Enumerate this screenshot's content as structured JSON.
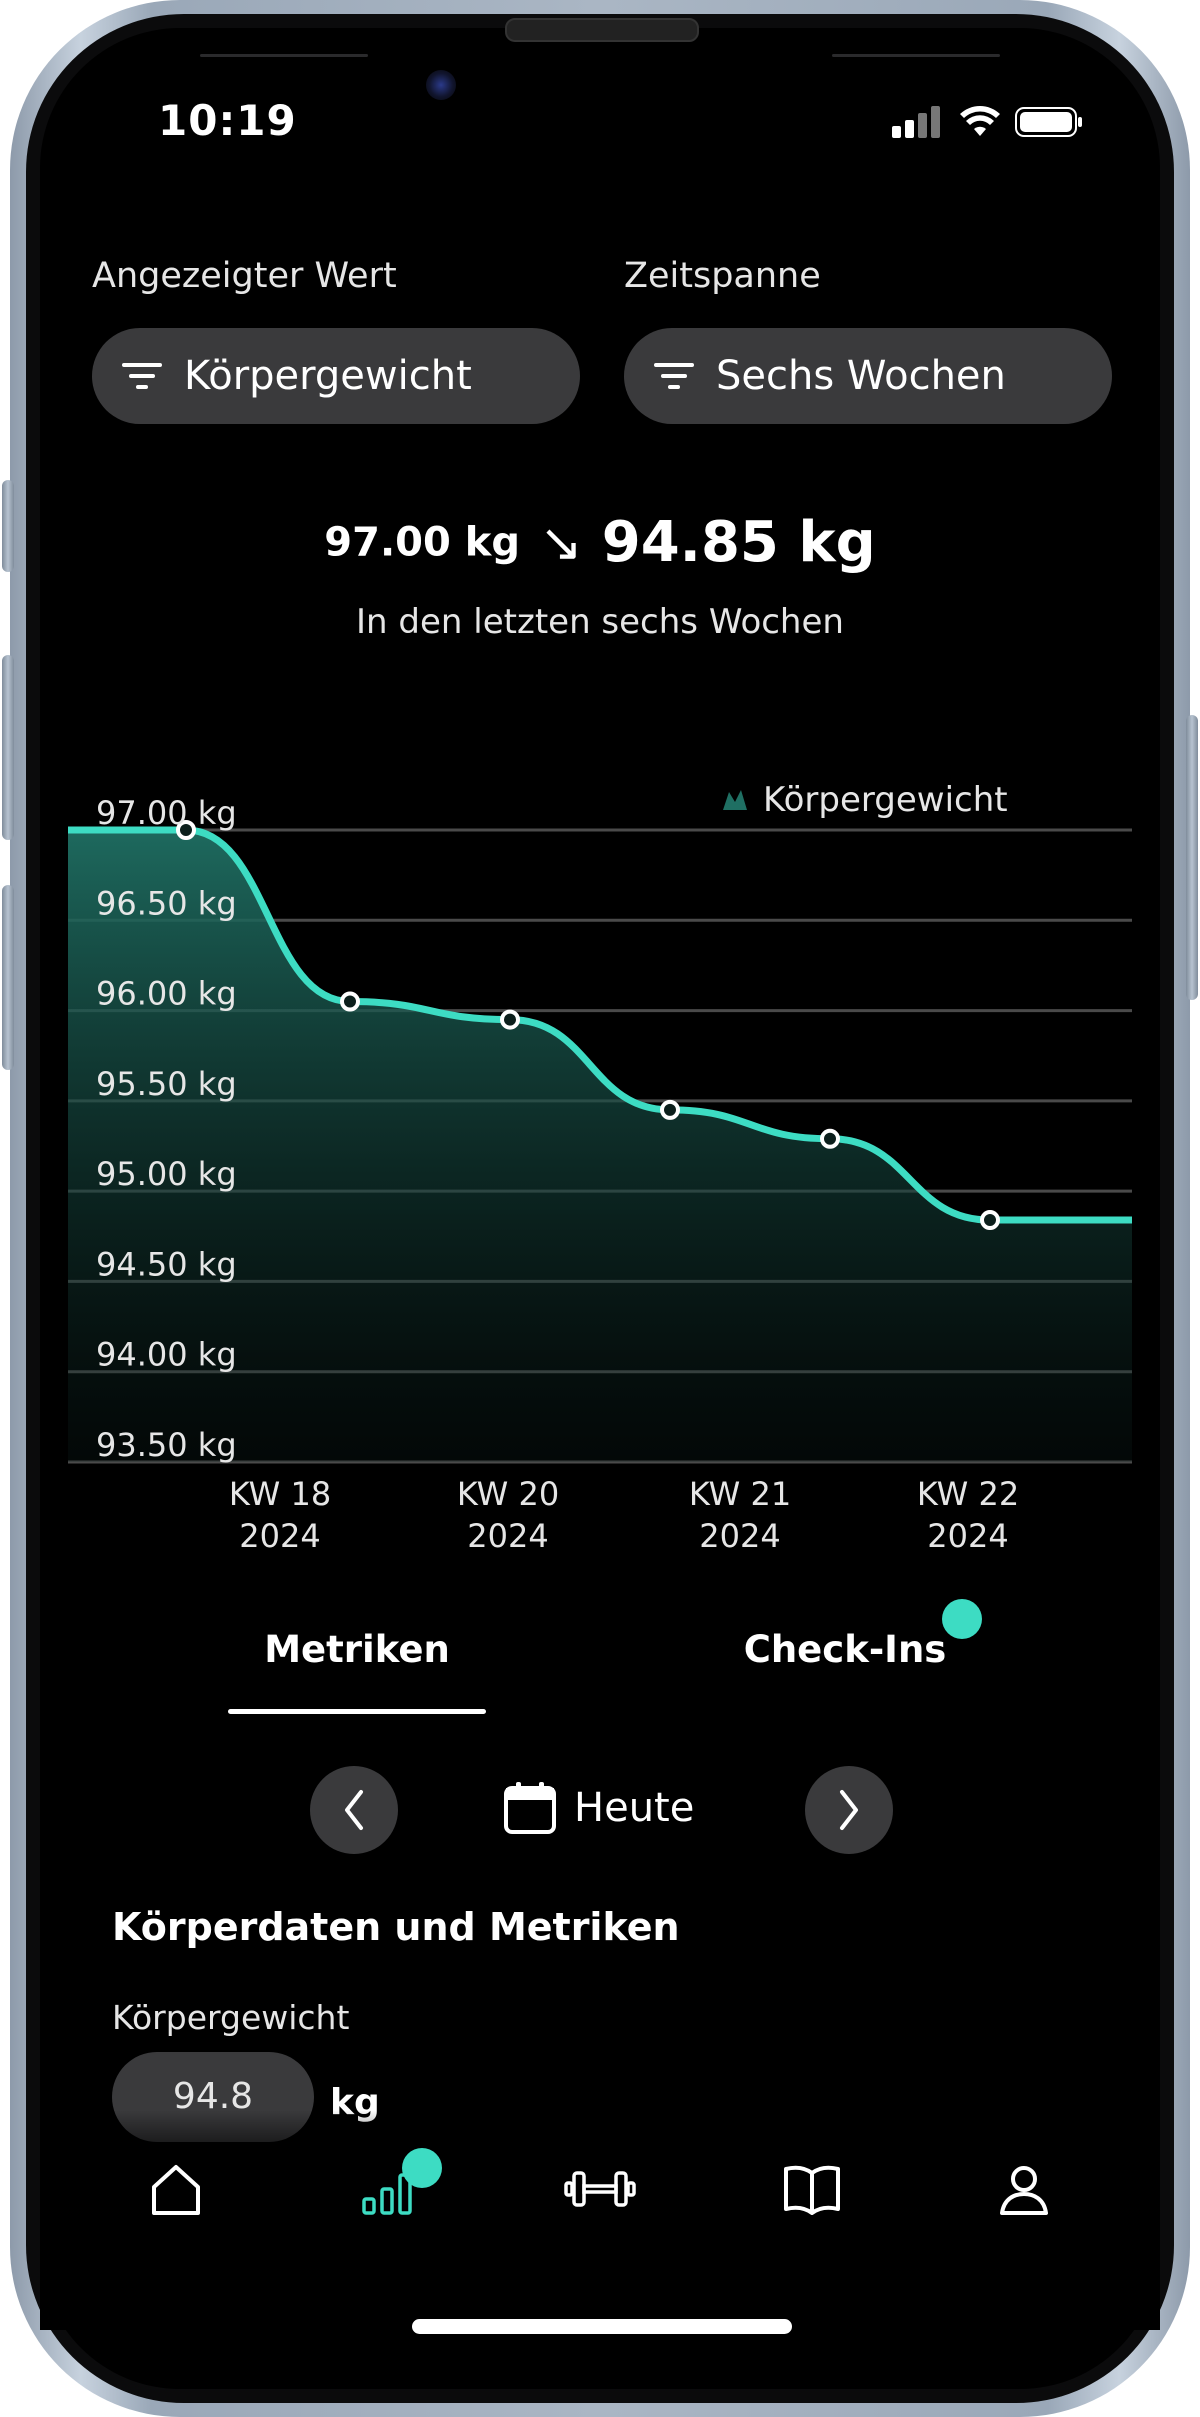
{
  "status_bar": {
    "time": "10:19"
  },
  "filters": {
    "value": {
      "label": "Angezeigter Wert",
      "selected": "Körpergewicht"
    },
    "timespan": {
      "label": "Zeitspanne",
      "selected": "Sechs Wochen"
    }
  },
  "summary": {
    "from": "97.00 kg",
    "arrow": "↘",
    "to": "94.85 kg",
    "subtitle": "In den letzten sechs Wochen"
  },
  "chart_data": {
    "type": "area",
    "series": [
      {
        "name": "Körpergewicht",
        "values": [
          97.0,
          96.05,
          95.95,
          95.45,
          95.29,
          94.84
        ]
      }
    ],
    "y_ticks": [
      "97.00 kg",
      "96.50 kg",
      "96.00 kg",
      "95.50 kg",
      "95.00 kg",
      "94.50 kg",
      "94.00 kg",
      "93.50 kg"
    ],
    "ylim": [
      93.5,
      97.0
    ],
    "x_ticks": [
      {
        "week": "KW 18",
        "year": "2024"
      },
      {
        "week": "KW 20",
        "year": "2024"
      },
      {
        "week": "KW 21",
        "year": "2024"
      },
      {
        "week": "KW 22",
        "year": "2024"
      }
    ],
    "legend_position": "top-right",
    "colors": {
      "line": "#3ddcc3",
      "fill_top": "#1f6f63",
      "grid": "#4a4a4a"
    },
    "grid": true
  },
  "tabs": [
    {
      "label": "Metriken",
      "active": true
    },
    {
      "label": "Check-Ins",
      "active": false,
      "badge": true
    }
  ],
  "date_nav": {
    "label": "Heute"
  },
  "body_data": {
    "title": "Körperdaten und Metriken",
    "weight_label": "Körpergewicht",
    "weight_value": "94.8",
    "weight_unit": "kg"
  },
  "tabbar": {
    "items": [
      "home-icon",
      "statistics-icon",
      "dumbbell-icon",
      "book-icon",
      "profile-icon"
    ],
    "active": "statistics-icon",
    "accent": "#3ddcc3"
  }
}
